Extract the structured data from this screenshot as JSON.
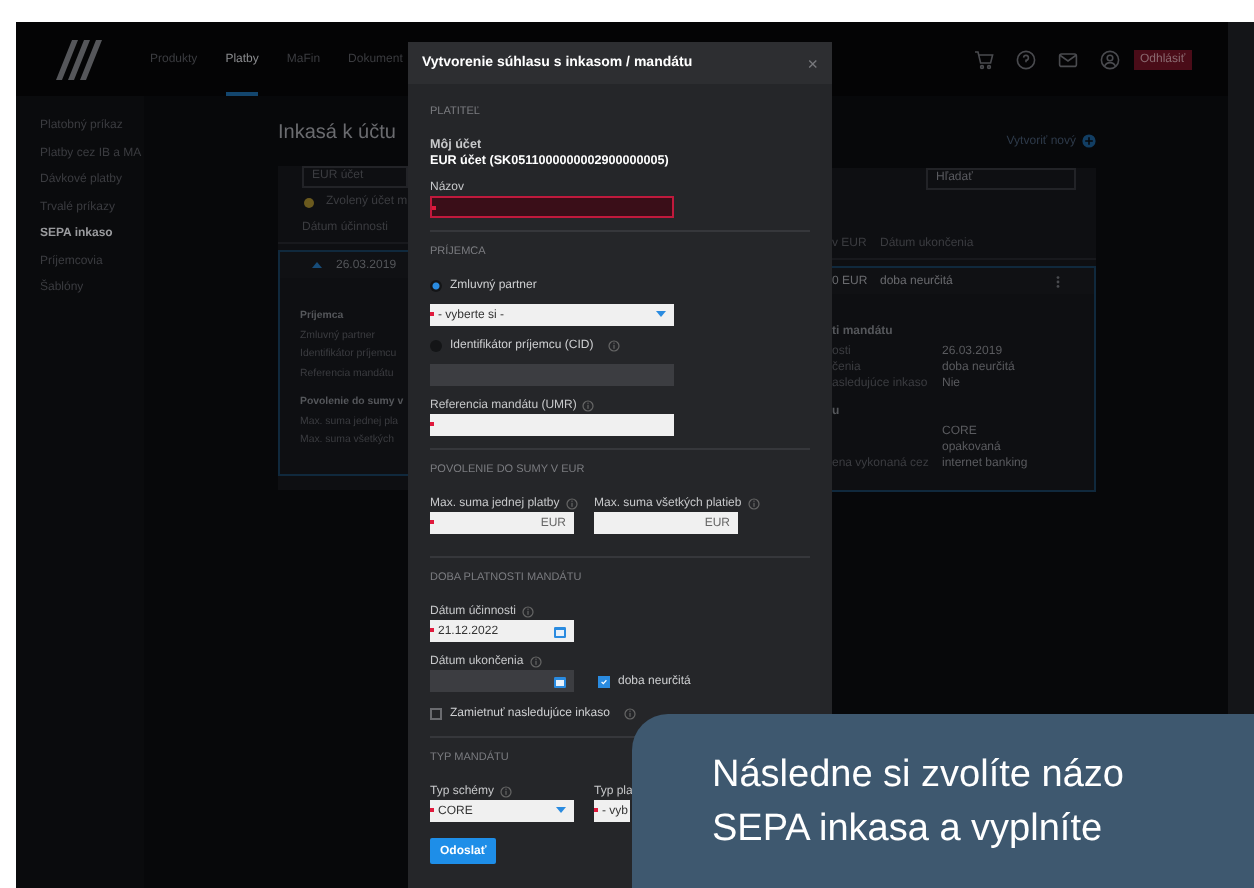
{
  "header": {
    "nav": [
      {
        "label": "Produkty",
        "selected": false
      },
      {
        "label": "Platby",
        "selected": true
      },
      {
        "label": "MaFin",
        "selected": false
      },
      {
        "label": "Dokument",
        "selected": false
      }
    ],
    "logout": "Odhlásiť"
  },
  "sidebar": {
    "items": [
      {
        "label": "Platobný príkaz",
        "selected": false
      },
      {
        "label": "Platby cez IB a MA",
        "selected": false
      },
      {
        "label": "Dávkové platby",
        "selected": false
      },
      {
        "label": "Trvalé príkazy",
        "selected": false
      },
      {
        "label": "SEPA inkaso",
        "selected": true
      },
      {
        "label": "Príjemcovia",
        "selected": false
      },
      {
        "label": "Šablóny",
        "selected": false
      }
    ]
  },
  "main": {
    "title": "Inkasá k účtu",
    "create": "Vytvoriť nový",
    "account_select": "EUR účet",
    "notice": "Zvolený účet m",
    "search": {
      "placeholder": "Hľadať"
    },
    "columns_left": [
      "Dátum účinnosti"
    ],
    "columns_right": [
      "v EUR",
      "Dátum ukončenia"
    ],
    "row": {
      "expanded": true,
      "date": "26.03.2019",
      "amount": "0 EUR",
      "end": "doba neurčitá"
    },
    "details_left": [
      {
        "kind": "heading",
        "text": "Príjemca"
      },
      {
        "kind": "line",
        "text": "Zmluvný partner"
      },
      {
        "kind": "line",
        "text": "Identifikátor príjemcu"
      },
      {
        "kind": "line",
        "text": "Referencia mandátu"
      },
      {
        "kind": "heading",
        "text": "Povolenie do sumy v"
      },
      {
        "kind": "line",
        "text": "Max. suma jednej pla"
      },
      {
        "kind": "line",
        "text": "Max. suma všetkých"
      }
    ],
    "details_right": [
      {
        "kind": "heading",
        "text": "ti mandátu"
      },
      {
        "kind": "row",
        "label": "osti",
        "value": "26.03.2019"
      },
      {
        "kind": "row",
        "label": "čenia",
        "value": "doba neurčitá"
      },
      {
        "kind": "row",
        "label": "asledujúce inkaso",
        "value": "Nie"
      },
      {
        "kind": "heading",
        "text": "u"
      },
      {
        "kind": "row",
        "value": "CORE"
      },
      {
        "kind": "row",
        "value": "opakovaná"
      },
      {
        "kind": "row",
        "label": "ena vykonaná cez",
        "value": "internet banking"
      }
    ]
  },
  "dialog": {
    "title": "Vytvorenie súhlasu s inkasom / mandátu",
    "close": "×",
    "sections": [
      {
        "heading": "PLATITEĽ",
        "items": [
          {
            "kind": "info",
            "label": "Môj účet",
            "value": "EUR účet (SK0511000000002900000005)"
          },
          {
            "kind": "text",
            "label": "Názov",
            "required": true,
            "error": true
          }
        ]
      },
      {
        "heading": "PRÍJEMCA",
        "items": [
          {
            "kind": "radio",
            "label": "Zmluvný partner",
            "selected": true
          },
          {
            "kind": "select",
            "value": "- vyberte si -",
            "required": true,
            "caret": true
          },
          {
            "kind": "radio",
            "label": "Identifikátor príjemcu (CID)",
            "selected": false,
            "help": true
          },
          {
            "kind": "text",
            "disabled": true
          },
          {
            "kind": "text",
            "label": "Referencia mandátu (UMR)",
            "help": true,
            "required": true
          }
        ]
      },
      {
        "heading": "POVOLENIE DO SUMY V EUR",
        "items": [
          {
            "kind": "pair",
            "fields": [
              {
                "kind": "amount",
                "label": "Max. suma jednej platby",
                "help": true,
                "unit": "EUR",
                "required": true
              },
              {
                "kind": "amount",
                "label": "Max. suma všetkých platieb",
                "help": true,
                "unit": "EUR"
              }
            ]
          }
        ]
      },
      {
        "heading": "DOBA PLATNOSTI MANDÁTU",
        "items": [
          {
            "kind": "date",
            "label": "Dátum účinnosti",
            "help": true,
            "value": "21.12.2022",
            "required": true
          },
          {
            "kind": "date_check",
            "label": "Dátum ukončenia",
            "help": true,
            "disabled": true,
            "check": {
              "label": "doba neurčitá",
              "checked": true
            }
          },
          {
            "kind": "checkbox",
            "label": "Zamietnuť nasledujúce inkaso",
            "checked": false,
            "help": true
          }
        ]
      },
      {
        "heading": "TYP MANDÁTU",
        "items": [
          {
            "kind": "pair",
            "fields": [
              {
                "kind": "select",
                "label": "Typ schémy",
                "help": true,
                "value": "CORE",
                "required": true,
                "caret": true
              },
              {
                "kind": "select",
                "label": "Typ pla",
                "value": "- vyb",
                "required": true
              }
            ]
          }
        ]
      }
    ],
    "submit": "Odoslať"
  },
  "hint": {
    "lines": [
      "Následne si zvolíte názo",
      "SEPA inkasa a vyplníte"
    ]
  }
}
